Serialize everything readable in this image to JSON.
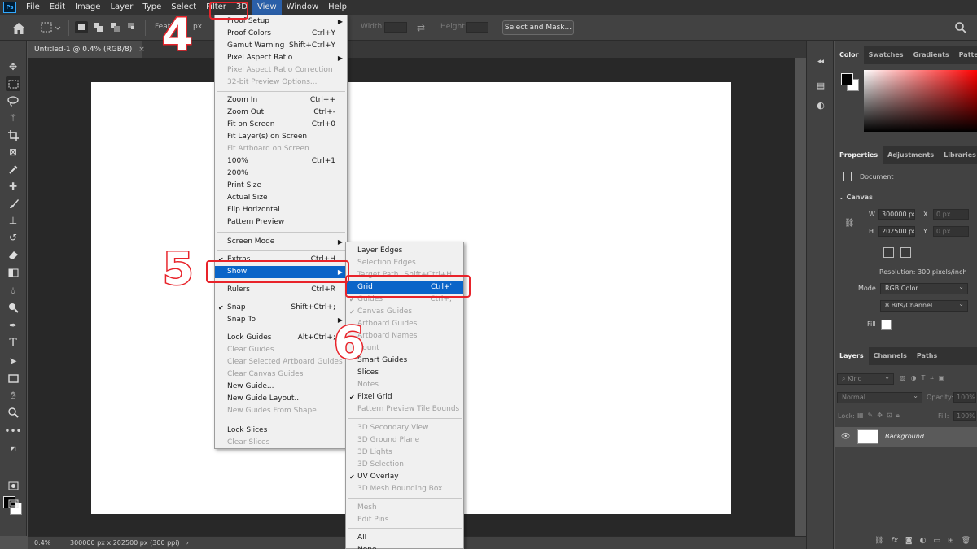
{
  "menubar": {
    "logo": "Ps",
    "items": [
      "File",
      "Edit",
      "Image",
      "Layer",
      "Type",
      "Select",
      "Filter",
      "3D",
      "View",
      "Window",
      "Help"
    ]
  },
  "options": {
    "feather_label": "Feath",
    "feather_unit": "px",
    "width_label": "Width:",
    "height_label": "Height:",
    "select_mask": "Select and Mask..."
  },
  "document": {
    "tab_title": "Untitled-1 @ 0.4% (RGB/8)",
    "close": "×"
  },
  "status": {
    "zoom": "0.4%",
    "doc_size": "300000 px x 202500 px (300 ppi)",
    "arrow": "›"
  },
  "color_panel": {
    "tabs": [
      "Color",
      "Swatches",
      "Gradients",
      "Patterns"
    ]
  },
  "properties_panel": {
    "tabs": [
      "Properties",
      "Adjustments",
      "Libraries"
    ],
    "section": "Document",
    "canvas_heading": "Canvas",
    "w_label": "W",
    "w_value": "300000 px",
    "h_label": "H",
    "h_value": "202500 px",
    "x_label": "X",
    "x_value": "0 px",
    "y_label": "Y",
    "y_value": "0 px",
    "resolution": "Resolution: 300 pixels/inch",
    "mode_label": "Mode",
    "mode_value": "RGB Color",
    "depth_value": "8 Bits/Channel",
    "fill_label": "Fill"
  },
  "layers_panel": {
    "tabs": [
      "Layers",
      "Channels",
      "Paths"
    ],
    "kind": "Kind",
    "blend": "Normal",
    "opacity_label": "Opacity:",
    "opacity_value": "100%",
    "lock_label": "Lock:",
    "fill_label": "Fill:",
    "fill_value": "100%",
    "layer_name": "Background"
  },
  "view_menu": {
    "items": [
      {
        "label": "Proof Setup",
        "shortcut": "",
        "arrow": true,
        "disabled": false
      },
      {
        "label": "Proof Colors",
        "shortcut": "Ctrl+Y",
        "disabled": false
      },
      {
        "label": "Gamut Warning",
        "shortcut": "Shift+Ctrl+Y",
        "disabled": false
      },
      {
        "label": "Pixel Aspect Ratio",
        "shortcut": "",
        "arrow": true,
        "disabled": false
      },
      {
        "label": "Pixel Aspect Ratio Correction",
        "shortcut": "",
        "disabled": true
      },
      {
        "label": "32-bit Preview Options...",
        "shortcut": "",
        "disabled": true
      },
      {
        "label": "Zoom In",
        "shortcut": "Ctrl++",
        "disabled": false
      },
      {
        "label": "Zoom Out",
        "shortcut": "Ctrl+-",
        "disabled": false
      },
      {
        "label": "Fit on Screen",
        "shortcut": "Ctrl+0",
        "disabled": false
      },
      {
        "label": "Fit Layer(s) on Screen",
        "shortcut": "",
        "disabled": false
      },
      {
        "label": "Fit Artboard on Screen",
        "shortcut": "",
        "disabled": true
      },
      {
        "label": "100%",
        "shortcut": "Ctrl+1",
        "disabled": false
      },
      {
        "label": "200%",
        "shortcut": "",
        "disabled": false
      },
      {
        "label": "Print Size",
        "shortcut": "",
        "disabled": false
      },
      {
        "label": "Actual Size",
        "shortcut": "",
        "disabled": false
      },
      {
        "label": "Flip Horizontal",
        "shortcut": "",
        "disabled": false
      },
      {
        "label": "Pattern Preview",
        "shortcut": "",
        "disabled": false
      },
      {
        "label": "Screen Mode",
        "shortcut": "",
        "arrow": true,
        "disabled": false
      },
      {
        "label": "Extras",
        "shortcut": "Ctrl+H",
        "checked": true,
        "disabled": false
      },
      {
        "label": "Show",
        "shortcut": "",
        "arrow": true,
        "highlight": true,
        "disabled": false
      },
      {
        "label": "Rulers",
        "shortcut": "Ctrl+R",
        "disabled": false
      },
      {
        "label": "Snap",
        "shortcut": "Shift+Ctrl+;",
        "checked": true,
        "disabled": false
      },
      {
        "label": "Snap To",
        "shortcut": "",
        "arrow": true,
        "disabled": false
      },
      {
        "label": "Lock Guides",
        "shortcut": "Alt+Ctrl+;",
        "disabled": false
      },
      {
        "label": "Clear Guides",
        "shortcut": "",
        "disabled": true
      },
      {
        "label": "Clear Selected Artboard Guides",
        "shortcut": "",
        "disabled": true
      },
      {
        "label": "Clear Canvas Guides",
        "shortcut": "",
        "disabled": true
      },
      {
        "label": "New Guide...",
        "shortcut": "",
        "disabled": false
      },
      {
        "label": "New Guide Layout...",
        "shortcut": "",
        "disabled": false
      },
      {
        "label": "New Guides From Shape",
        "shortcut": "",
        "disabled": true
      },
      {
        "label": "Lock Slices",
        "shortcut": "",
        "disabled": false
      },
      {
        "label": "Clear Slices",
        "shortcut": "",
        "disabled": true
      }
    ]
  },
  "show_submenu": {
    "items": [
      {
        "label": "Layer Edges",
        "shortcut": "",
        "disabled": false
      },
      {
        "label": "Selection Edges",
        "shortcut": "",
        "disabled": true
      },
      {
        "label": "Target Path",
        "shortcut": "Shift+Ctrl+H",
        "disabled": true
      },
      {
        "label": "Grid",
        "shortcut": "Ctrl+'",
        "highlight": true,
        "disabled": false
      },
      {
        "label": "Guides",
        "shortcut": "Ctrl+;",
        "checked": true,
        "disabled": true
      },
      {
        "label": "Canvas Guides",
        "shortcut": "",
        "checked": true,
        "disabled": true
      },
      {
        "label": "Artboard Guides",
        "shortcut": "",
        "disabled": true
      },
      {
        "label": "Artboard Names",
        "shortcut": "",
        "disabled": true
      },
      {
        "label": "Count",
        "shortcut": "",
        "disabled": true
      },
      {
        "label": "Smart Guides",
        "shortcut": "",
        "disabled": false
      },
      {
        "label": "Slices",
        "shortcut": "",
        "disabled": false
      },
      {
        "label": "Notes",
        "shortcut": "",
        "disabled": true
      },
      {
        "label": "Pixel Grid",
        "shortcut": "",
        "checked": true,
        "disabled": false
      },
      {
        "label": "Pattern Preview Tile Bounds",
        "shortcut": "",
        "disabled": true
      },
      {
        "label": "3D Secondary View",
        "shortcut": "",
        "disabled": true
      },
      {
        "label": "3D Ground Plane",
        "shortcut": "",
        "disabled": true
      },
      {
        "label": "3D Lights",
        "shortcut": "",
        "disabled": true
      },
      {
        "label": "3D Selection",
        "shortcut": "",
        "disabled": true
      },
      {
        "label": "UV Overlay",
        "shortcut": "",
        "checked": true,
        "disabled": false
      },
      {
        "label": "3D Mesh Bounding Box",
        "shortcut": "",
        "disabled": true
      },
      {
        "label": "Mesh",
        "shortcut": "",
        "disabled": true
      },
      {
        "label": "Edit Pins",
        "shortcut": "",
        "disabled": true
      },
      {
        "label": "All",
        "shortcut": "",
        "disabled": false
      },
      {
        "label": "None",
        "shortcut": "",
        "disabled": false
      }
    ]
  },
  "annotations": {
    "step4": "4",
    "step5": "5",
    "step6": "6",
    "accent_color": "#e8232a",
    "highlight_color": "#0a64c8"
  }
}
